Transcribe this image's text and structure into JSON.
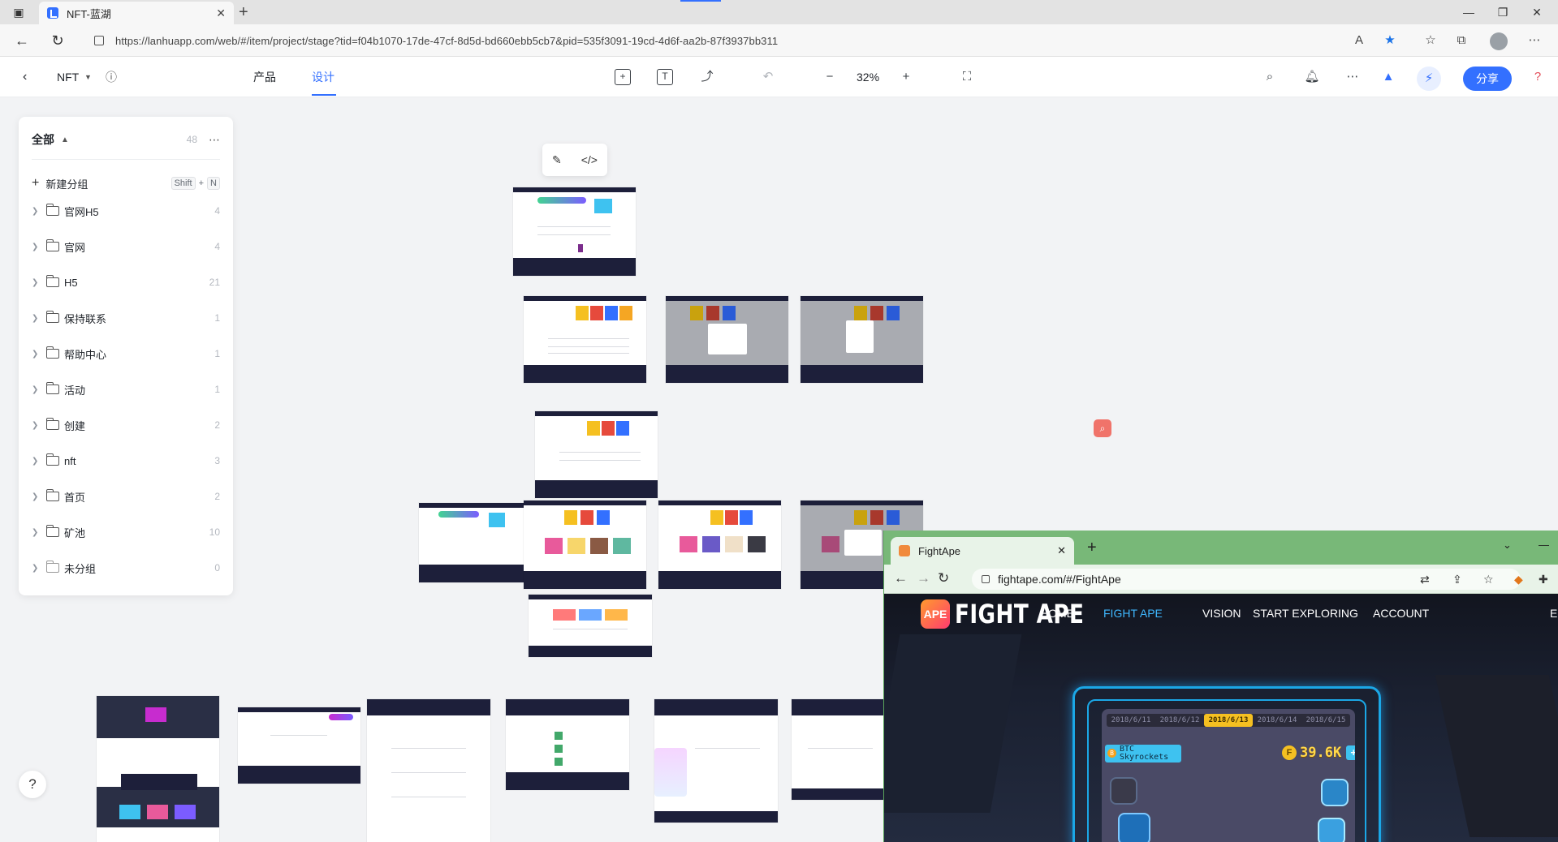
{
  "browser": {
    "tab_title": "NFT-蓝湖",
    "url": "https://lanhuapp.com/web/#/item/project/stage?tid=f04b1070-17de-47cf-8d5d-bd660ebb5cb7&pid=535f3091-19cd-4d6f-aa2b-87f3937bb311"
  },
  "app": {
    "project_name": "NFT",
    "tabs": [
      {
        "label": "产品",
        "active": false
      },
      {
        "label": "设计",
        "active": true
      }
    ],
    "zoom": "32%",
    "share_label": "分享",
    "accent": "#3370ff"
  },
  "panel": {
    "title": "全部",
    "total": "48",
    "new_group_label": "新建分组",
    "shortcut_mod": "Shift",
    "shortcut_plus": "+",
    "shortcut_key": "N",
    "groups": [
      {
        "name": "官网H5",
        "count": "4"
      },
      {
        "name": "官网",
        "count": "4"
      },
      {
        "name": "H5",
        "count": "21"
      },
      {
        "name": "保持联系",
        "count": "1"
      },
      {
        "name": "帮助中心",
        "count": "1"
      },
      {
        "name": "活动",
        "count": "1"
      },
      {
        "name": "创建",
        "count": "2"
      },
      {
        "name": "nft",
        "count": "3"
      },
      {
        "name": "首页",
        "count": "2"
      },
      {
        "name": "矿池",
        "count": "10"
      },
      {
        "name": "未分组",
        "count": "0"
      }
    ]
  },
  "help": {
    "label": "?"
  },
  "fightape": {
    "tab_title": "FightApe",
    "url": "fightape.com/#/FightApe",
    "logo_badge": "APE",
    "logo_text": "FIGHT APE",
    "nav": [
      {
        "label": "HOME",
        "active": false
      },
      {
        "label": "FIGHT APE",
        "active": true
      },
      {
        "label": "VISION",
        "active": false
      },
      {
        "label": "START EXPLORING",
        "active": false
      },
      {
        "label": "ACCOUNT",
        "active": false
      }
    ],
    "dates": [
      "2018/6/11",
      "2018/6/12",
      "2018/6/13",
      "2018/6/14",
      "2018/6/15"
    ],
    "news_line1": "BTC",
    "news_line2": "Skyrockets",
    "balance": "39.6K",
    "coin_letter": "F",
    "plus": "+"
  }
}
